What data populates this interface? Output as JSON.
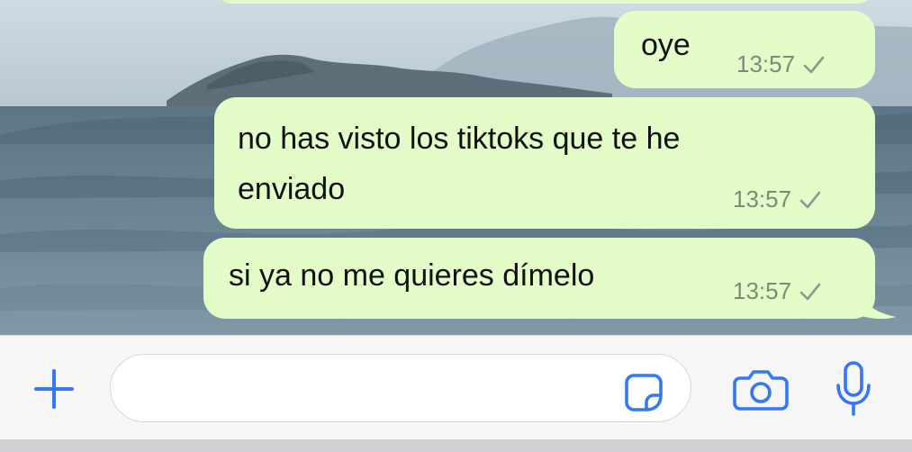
{
  "chat": {
    "messages": [
      {
        "text": "oye",
        "time": "13:57",
        "status": "sent-check-icon"
      },
      {
        "text_line1": "no has visto los tiktoks que te he",
        "text_line2": "enviado",
        "time": "13:57",
        "status": "sent-check-icon"
      },
      {
        "text": "si ya no me quieres dímelo",
        "time": "13:57",
        "status": "sent-check-icon"
      }
    ]
  },
  "input_bar": {
    "message_value": "",
    "message_placeholder": "",
    "icons": [
      "plus-icon",
      "sticker-icon",
      "camera-icon",
      "microphone-icon"
    ]
  },
  "colors": {
    "bubble_outgoing": "#e3fcc8",
    "accent_blue": "#3478f6",
    "timestamp": "#7c8a7a",
    "input_bar_bg": "#f6f6f7"
  }
}
